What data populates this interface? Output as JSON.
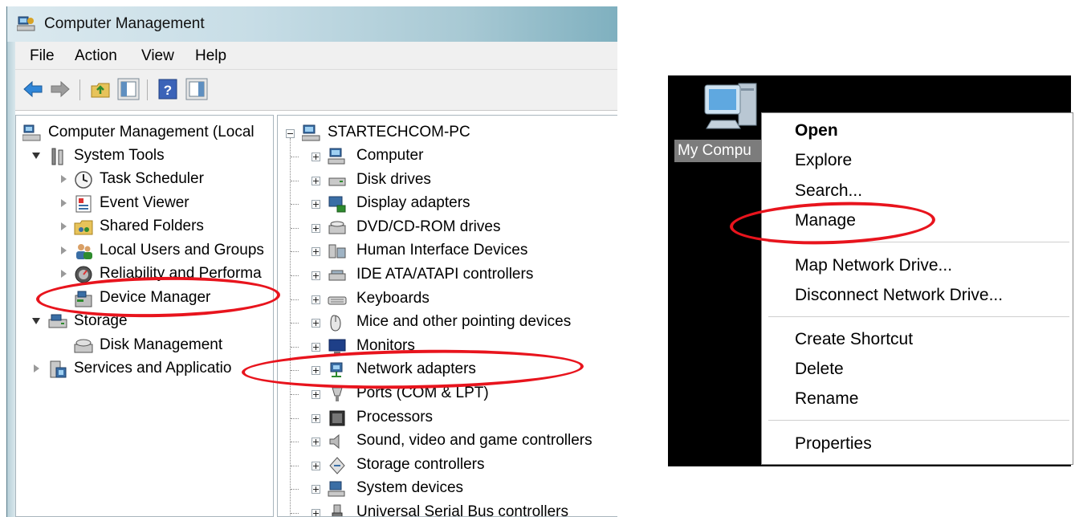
{
  "window": {
    "title": "Computer Management",
    "menu": [
      "File",
      "Action",
      "View",
      "Help"
    ]
  },
  "left_tree": {
    "root": "Computer Management (Local",
    "system_tools": "System Tools",
    "task_scheduler": "Task Scheduler",
    "event_viewer": "Event Viewer",
    "shared_folders": "Shared Folders",
    "local_users": "Local Users and Groups",
    "reliability": "Reliability and Performa",
    "device_manager": "Device Manager",
    "storage": "Storage",
    "disk_management": "Disk Management",
    "services": "Services and Applicatio"
  },
  "device_tree": {
    "root": "STARTECHCOM-PC",
    "items": [
      "Computer",
      "Disk drives",
      "Display adapters",
      "DVD/CD-ROM drives",
      "Human Interface Devices",
      "IDE ATA/ATAPI controllers",
      "Keyboards",
      "Mice and other pointing devices",
      "Monitors",
      "Network adapters",
      "Ports (COM & LPT)",
      "Processors",
      "Sound, video and game controllers",
      "Storage controllers",
      "System devices",
      "Universal Serial Bus controllers"
    ]
  },
  "desktop": {
    "icon_label": "My Compu"
  },
  "context_menu": {
    "open": "Open",
    "explore": "Explore",
    "search": "Search...",
    "manage": "Manage",
    "map_drive": "Map Network Drive...",
    "disconnect_drive": "Disconnect Network Drive...",
    "create_shortcut": "Create Shortcut",
    "delete": "Delete",
    "rename": "Rename",
    "properties": "Properties"
  },
  "colors": {
    "highlight_ellipse": "#e8141d",
    "desktop_background": "#000000",
    "title_gradient_end": "#7fb0bf"
  }
}
